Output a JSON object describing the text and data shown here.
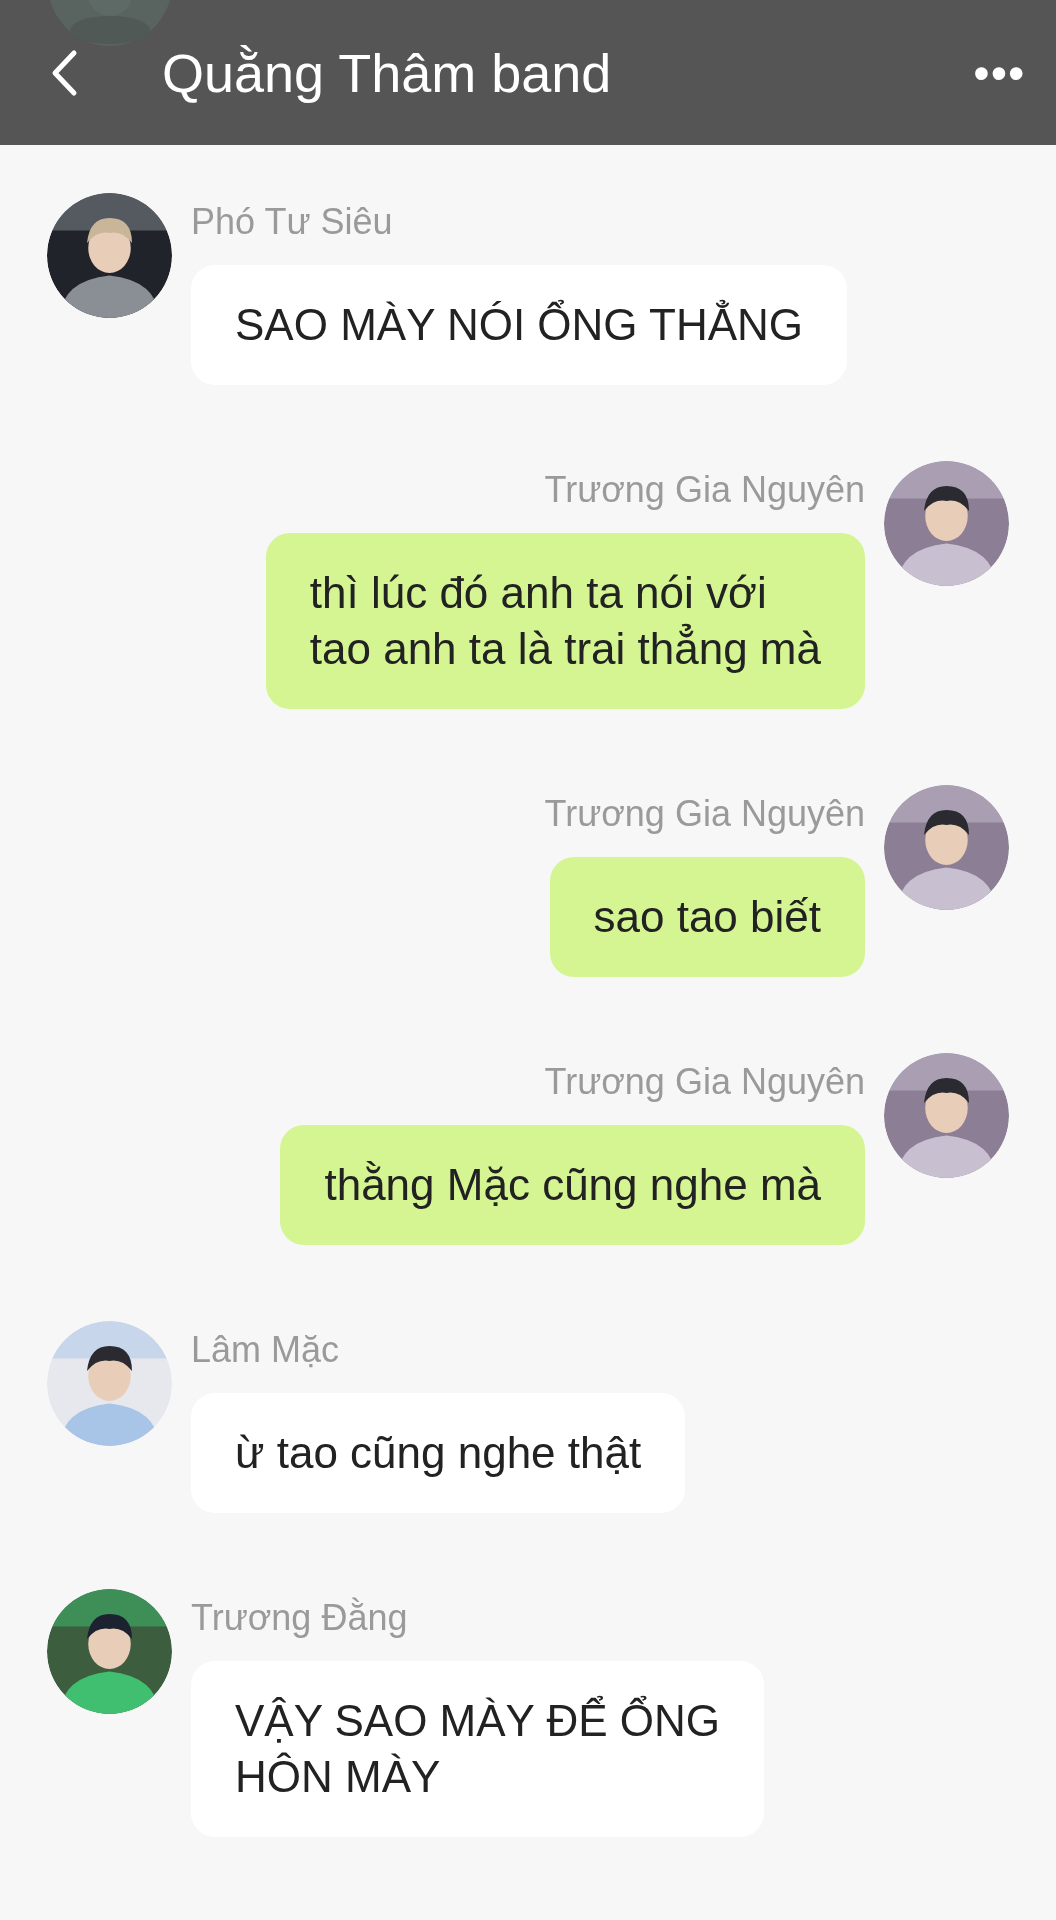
{
  "header": {
    "title": "Quằng Thâm band",
    "more": "•••"
  },
  "messages": [
    {
      "kind": "received",
      "sender": "Phó Tư Siêu",
      "lines": [
        "SAO MÀY NÓI ỔNG THẲNG"
      ]
    },
    {
      "kind": "sent",
      "sender": "Trương Gia Nguyên",
      "lines": [
        "thì lúc đó anh ta nói với",
        "tao anh ta là trai thẳng mà"
      ]
    },
    {
      "kind": "sent",
      "sender": "Trương Gia Nguyên",
      "lines": [
        "sao tao biết"
      ]
    },
    {
      "kind": "sent",
      "sender": "Trương Gia Nguyên",
      "lines": [
        "thằng Mặc cũng nghe mà"
      ]
    },
    {
      "kind": "received",
      "sender": "Lâm Mặc",
      "lines": [
        "ừ tao cũng nghe thật"
      ]
    },
    {
      "kind": "received",
      "sender": "Trương Đằng",
      "lines": [
        "VẬY SAO MÀY ĐỂ ỔNG",
        "HÔN MÀY"
      ]
    }
  ]
}
